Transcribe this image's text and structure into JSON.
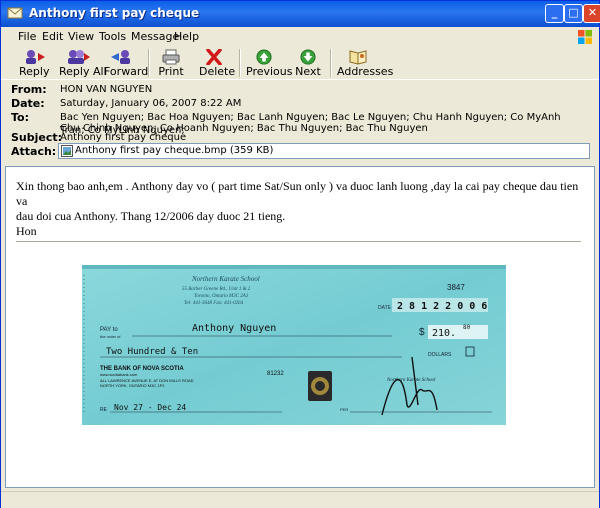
{
  "window": {
    "title": "Anthony first pay cheque"
  },
  "menu": [
    "File",
    "Edit",
    "View",
    "Tools",
    "Message",
    "Help"
  ],
  "toolbar": {
    "reply": "Reply",
    "reply_all": "Reply All",
    "forward": "Forward",
    "print": "Print",
    "delete": "Delete",
    "previous": "Previous",
    "next": "Next",
    "addresses": "Addresses"
  },
  "headers": {
    "from_label": "From:",
    "from": "HON VAN NGUYEN",
    "date_label": "Date:",
    "date": "Saturday, January 06, 2007 8:22 AM",
    "to_label": "To:",
    "to_line1": "Bac Yen Nguyen; Bac Hoa Nguyen; Bac Lanh Nguyen; Bac Le Nguyen; Chu Hanh Nguyen; Co MyAnh Tran; Co MyLinh Nguyen;",
    "to_line2": "Chu Chinh Nguyen; Co Hoanh Nguyen; Bac Thu Nguyen; Bac Thu Nguyen",
    "subject_label": "Subject:",
    "subject": "Anthony first pay cheque",
    "attach_label": "Attach:",
    "attachment": "Anthony first pay cheque.bmp (359 KB)"
  },
  "message": {
    "line1": "Xin thong bao anh,em . Anthony day vo ( part time Sat/Sun  only ) va duoc lanh luong ,day la cai pay cheque dau tien va",
    "line2": "dau doi cua Anthony. Thang 12/2006 day duoc 21 tieng.",
    "line3": "Hon"
  },
  "cheque": {
    "payer_name": "Northern Karate School",
    "payer_address1": "55 Barber Greene Rd., Unit 1 & 2",
    "payer_address2": "Toronto, Ontario  M3C 2A1",
    "payer_phone": "Tel: 441-3648  Fax: 441-0264",
    "cheque_number": "3847",
    "date_label": "DATE",
    "date_value": "2 8 1 2 2 0 0 6",
    "pay_label": "PAY to",
    "order_label": "the order of",
    "payee": "Anthony Nguyen",
    "amount_symbol": "$",
    "amount": "210.",
    "cents": "80",
    "written_amount": "Two Hundred & Ten",
    "dollars_label": "DOLLARS",
    "bank_name": "THE BANK OF NOVA SCOTIA",
    "bank_site": "www.scotiabank.com",
    "bank_address1": "ALL LAWRENCE AVENUE E. AT DON MILLS ROAD",
    "bank_address2": "NORTH YORK, ONTARIO  M3C 1P2",
    "bank_code": "81232",
    "re_label": "RE",
    "memo": "Nov 27 - Dec 24",
    "per_label": "PER",
    "signature_company": "Northern Karate School"
  },
  "colors": {
    "cheque_bg": "#7dd0d4",
    "title_bar": "#0a5ee8"
  }
}
